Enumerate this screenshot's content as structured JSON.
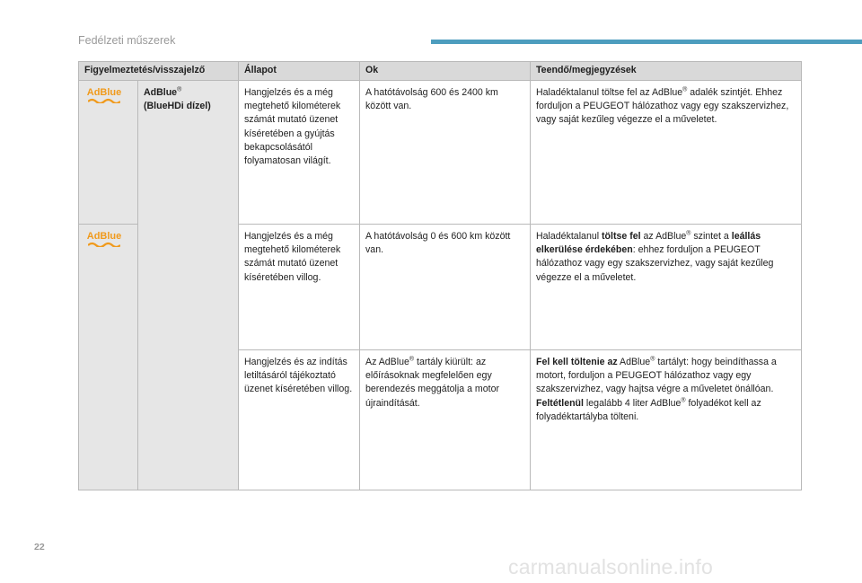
{
  "header": {
    "section_title": "Fedélzeti műszerek"
  },
  "table": {
    "columns": [
      "Figyelmeztetés/visszajelző",
      "Állapot",
      "Ok",
      "Teendő/megjegyzések"
    ],
    "warning": {
      "icon_text": "AdBlue",
      "name": "AdBlue",
      "name_sup": "®",
      "name_sub": "(BlueHDi dízel)"
    },
    "rows": [
      {
        "state": "Hangjelzés és a még megtehető kilométerek számát mutató üzenet kíséretében a gyújtás bekapcsolásától folyamatosan világít.",
        "cause": "A hatótávolság 600 és 2400 km között van.",
        "action": {
          "t1": "Haladéktalanul töltse fel az AdBlue",
          "sup1": "®",
          "t2": " adalék szintjét. Ehhez forduljon a PEUGEOT hálózathoz vagy egy szakszervizhez, vagy saját kezűleg végezze el a műveletet."
        }
      },
      {
        "state": "Hangjelzés és a még megtehető kilométerek számát mutató üzenet kíséretében villog.",
        "cause": "A hatótávolság 0 és 600 km között van.",
        "action": {
          "t1": "Haladéktalanul ",
          "b1": "töltse fel",
          "t2": " az AdBlue",
          "sup1": "®",
          "t3": " szintet a ",
          "b2": "leállás elkerülése érdekében",
          "t4": ": ehhez forduljon a PEUGEOT hálózathoz vagy egy szakszervizhez, vagy saját kezűleg végezze el a műveletet."
        }
      },
      {
        "state": "Hangjelzés és az indítás letiltásáról tájékoztató üzenet kíséretében villog.",
        "cause": {
          "t1": "Az AdBlue",
          "sup1": "®",
          "t2": " tartály kiürült: az előírásoknak megfelelően egy berendezés meggátolja a motor újraindítását."
        },
        "action": {
          "b1": "Fel kell töltenie az",
          "t1": " AdBlue",
          "sup1": "®",
          "t2": " tartályt: hogy beindíthassa a motort, forduljon a PEUGEOT hálózathoz vagy egy szakszervizhez, vagy hajtsa végre a műveletet önállóan.",
          "b2": "Feltétlenül",
          "t3": " legalább 4 liter AdBlue",
          "sup2": "®",
          "t4": " folyadékot kell az folyadéktartályba tölteni."
        }
      }
    ]
  },
  "footer": {
    "page_number": "22",
    "watermark": "carmanualsonline.info"
  },
  "colors": {
    "accent_rule": "#4d9dbe",
    "adblue_icon": "#f09a1c",
    "header_bg": "#d9d9d9"
  }
}
